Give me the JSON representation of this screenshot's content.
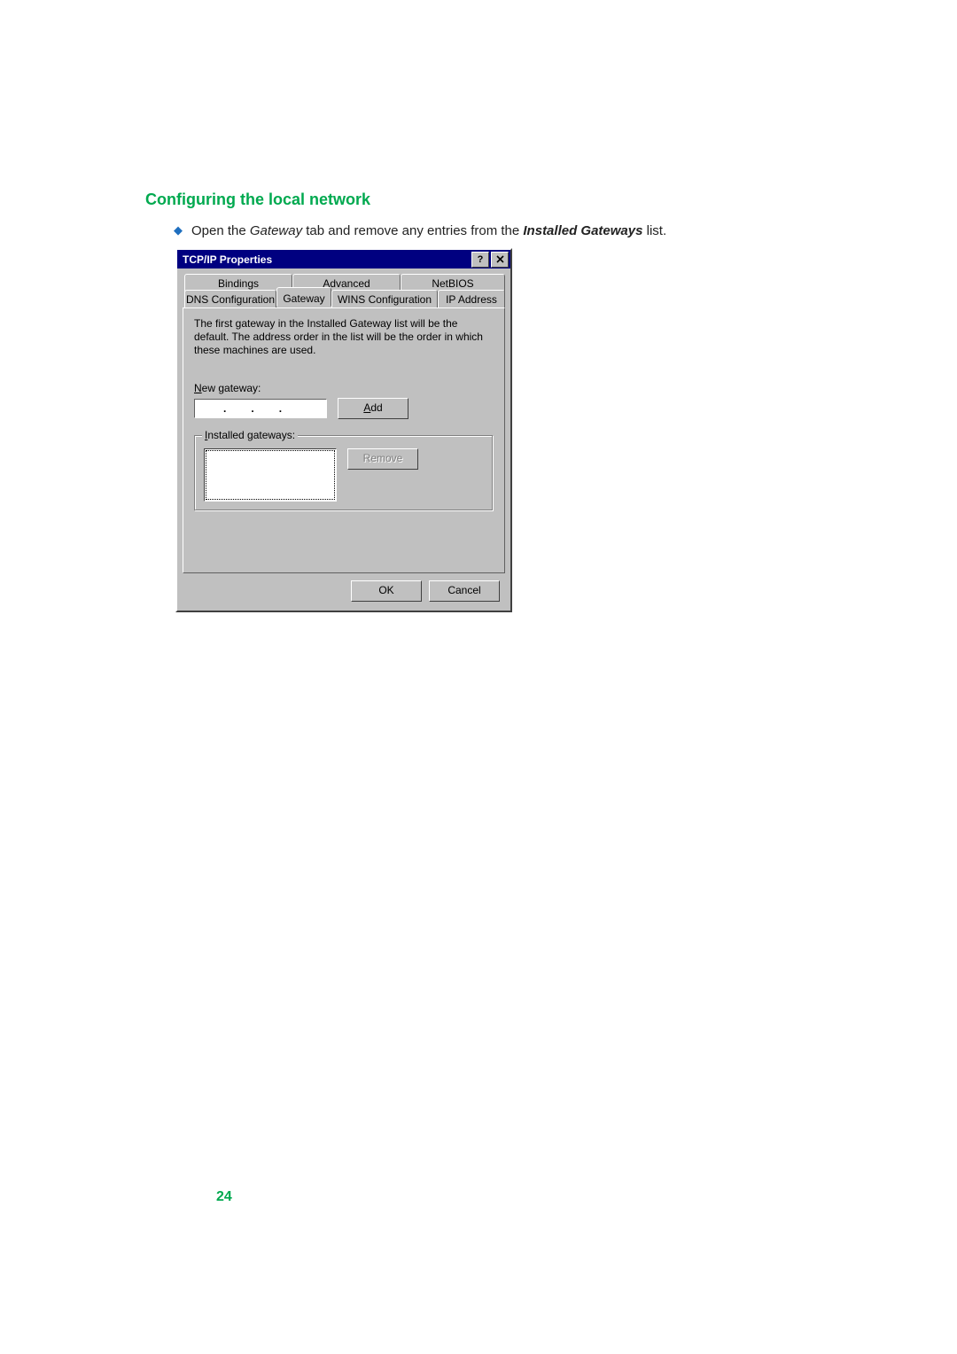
{
  "heading": "Configuring the local network",
  "bullet": {
    "prefix": "Open the ",
    "em1": "Gateway",
    "mid": " tab and remove any entries from the ",
    "strong": "Installed Gateways",
    "suffix": " list."
  },
  "dialog": {
    "title": "TCP/IP Properties",
    "tabs_back": [
      "Bindings",
      "Advanced",
      "NetBIOS"
    ],
    "tabs_front": [
      "DNS Configuration",
      "Gateway",
      "WINS Configuration",
      "IP Address"
    ],
    "active_tab": "Gateway",
    "description": "The first gateway in the Installed Gateway list will be the default. The address order in the list will be the order in which these machines are used.",
    "new_gateway_label": "New gateway:",
    "add_label": "Add",
    "installed_label": "Installed gateways:",
    "remove_label": "Remove",
    "ok_label": "OK",
    "cancel_label": "Cancel"
  },
  "page_number": "24"
}
